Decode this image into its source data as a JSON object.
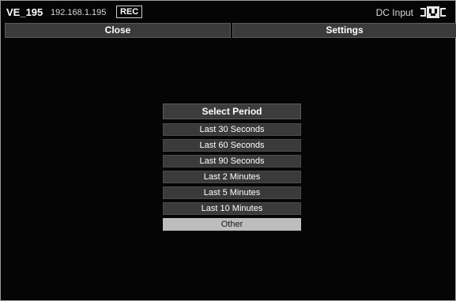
{
  "header": {
    "device_name": "VE_195",
    "ip_address": "192.168.1.195",
    "rec_badge": "REC",
    "power_status": "DC Input",
    "power_icon": "dc-plug-icon"
  },
  "toolbar": {
    "close_label": "Close",
    "settings_label": "Settings"
  },
  "period_menu": {
    "title": "Select Period",
    "items": [
      "Last 30 Seconds",
      "Last 60 Seconds",
      "Last 90 Seconds",
      "Last 2 Minutes",
      "Last 5 Minutes",
      "Last 10 Minutes",
      "Other"
    ],
    "selected": "Other"
  },
  "colors": {
    "background": "#050505",
    "button": "#3a3a3a",
    "selected_item": "#bdbdbd",
    "text": "#ffffff"
  }
}
